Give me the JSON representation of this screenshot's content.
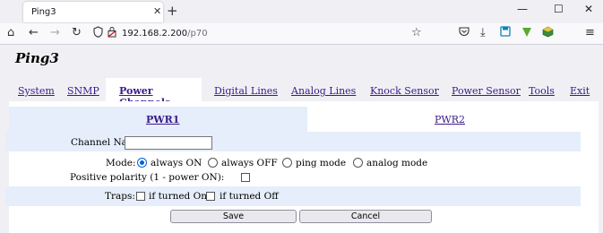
{
  "browser": {
    "tab_title": "Ping3",
    "tab_close": "✕",
    "new_tab": "+",
    "controls": {
      "minimize": "—",
      "maximize": "☐",
      "close": "✕"
    },
    "url_host": "192.168.2.200",
    "url_path": "/p70",
    "icons": [
      "home-icon",
      "back-icon",
      "forward-icon",
      "reload-icon",
      "shield-icon",
      "lock-icon",
      "bookmark-star-icon",
      "pocket-icon",
      "download-icon",
      "save-icon",
      "extension-icon",
      "extension-cube-icon",
      "menu-icon"
    ]
  },
  "app": {
    "title": "Ping3"
  },
  "menu": {
    "items": [
      "System",
      "SNMP",
      "Power Channels",
      "Digital Lines",
      "Analog Lines",
      "Knock Sensor",
      "Power Sensor",
      "Tools",
      "Exit"
    ],
    "active": "Power Channels"
  },
  "subtabs": {
    "items": [
      "PWR1",
      "PWR2"
    ],
    "active": "PWR1"
  },
  "form": {
    "channel_name_label": "Channel Name:",
    "channel_name_value": "",
    "mode_label": "Mode:",
    "mode_options": [
      "always ON",
      "always OFF",
      "ping mode",
      "analog mode"
    ],
    "mode_selected": "always ON",
    "polarity_label": "Positive polarity (1 - power ON):",
    "polarity_checked": false,
    "traps_label": "Traps:",
    "traps_options": [
      "if turned On",
      "if turned Off"
    ]
  },
  "buttons": {
    "save": "Save",
    "cancel": "Cancel"
  },
  "colors": {
    "link": "#3b1a8a",
    "band": "#e5eefa",
    "radio_accent": "#0060df"
  }
}
